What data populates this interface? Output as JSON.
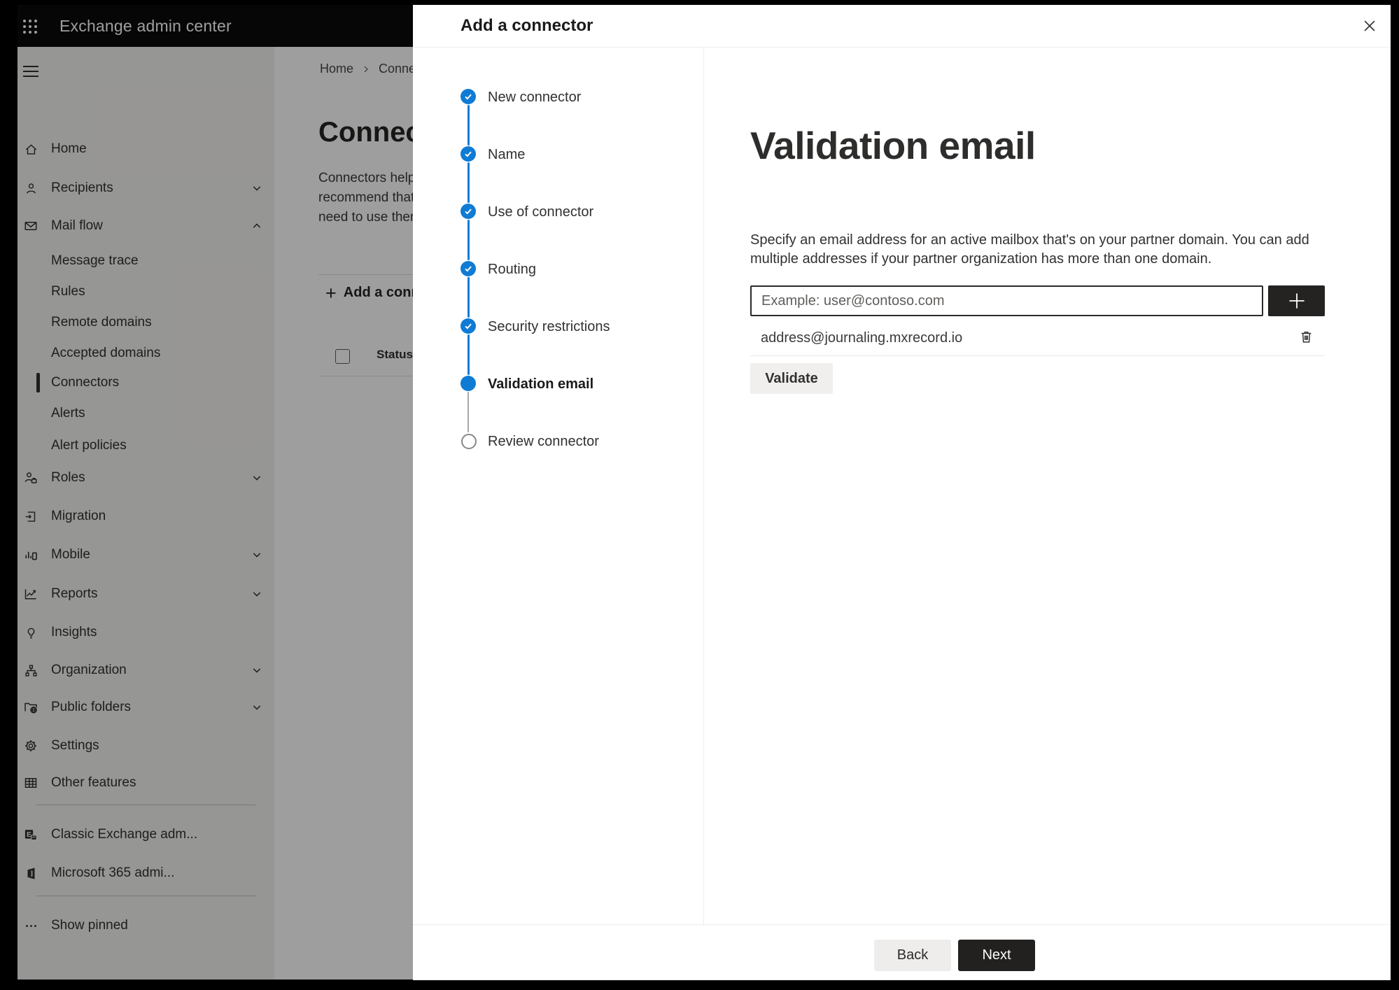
{
  "app": {
    "title": "Exchange admin center"
  },
  "sidebar": {
    "items": [
      {
        "label": "Home"
      },
      {
        "label": "Recipients"
      },
      {
        "label": "Mail flow"
      },
      {
        "label": "Message trace"
      },
      {
        "label": "Rules"
      },
      {
        "label": "Remote domains"
      },
      {
        "label": "Accepted domains"
      },
      {
        "label": "Connectors"
      },
      {
        "label": "Alerts"
      },
      {
        "label": "Alert policies"
      },
      {
        "label": "Roles"
      },
      {
        "label": "Migration"
      },
      {
        "label": "Mobile"
      },
      {
        "label": "Reports"
      },
      {
        "label": "Insights"
      },
      {
        "label": "Organization"
      },
      {
        "label": "Public folders"
      },
      {
        "label": "Settings"
      },
      {
        "label": "Other features"
      },
      {
        "label": "Classic Exchange adm..."
      },
      {
        "label": "Microsoft 365 admi..."
      },
      {
        "label": "Show pinned"
      }
    ]
  },
  "page": {
    "breadcrumb": {
      "home": "Home",
      "current": "Conne"
    },
    "heading": "Connect",
    "paragraph": "Connectors help\nrecommend that\nneed to use ther",
    "add_button": "Add a conn",
    "add_plus": "+",
    "table_header_status": "Status"
  },
  "modal": {
    "title": "Add a connector",
    "steps": [
      {
        "label": "New connector",
        "state": "completed"
      },
      {
        "label": "Name",
        "state": "completed"
      },
      {
        "label": "Use of connector",
        "state": "completed"
      },
      {
        "label": "Routing",
        "state": "completed"
      },
      {
        "label": "Security restrictions",
        "state": "completed"
      },
      {
        "label": "Validation email",
        "state": "active"
      },
      {
        "label": "Review connector",
        "state": "pending"
      }
    ],
    "content": {
      "heading": "Validation email",
      "description": "Specify an email address for an active mailbox that's on your partner domain. You can add\nmultiple addresses if your partner organization has more than one domain.",
      "input_placeholder": "Example: user@contoso.com",
      "address_0": "address@journaling.mxrecord.io",
      "validate_label": "Validate"
    },
    "footer": {
      "back_label": "Back",
      "next_label": "Next"
    }
  },
  "colors": {
    "accent_blue": "#0f7bd4",
    "topbar": "#0b0a0a",
    "sidebar_bg": "#f3f2f1",
    "dark_button": "#242322"
  }
}
